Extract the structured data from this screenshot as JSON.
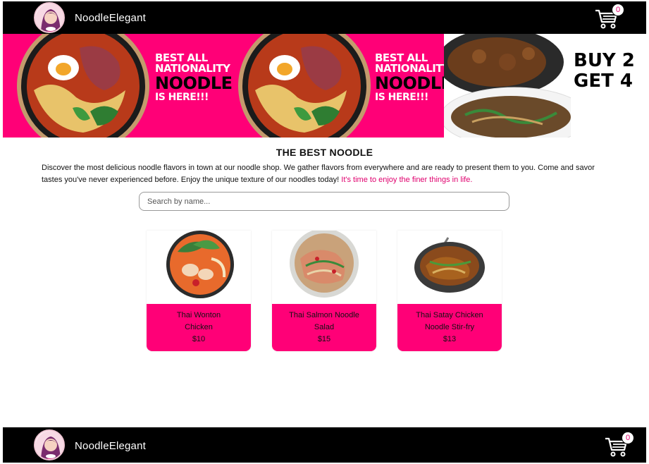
{
  "header": {
    "brand": "NoodleElegant",
    "cart_count": "0",
    "logo_icon": "noodle-girl-avatar-icon",
    "cart_icon": "shopping-cart-icon"
  },
  "banner": {
    "panels": [
      {
        "lines": [
          "BEST ALL",
          "NATIONALITY",
          "NOODLE",
          "IS HERE!!!"
        ]
      },
      {
        "lines": [
          "BEST ALL",
          "NATIONALITY",
          "NOODLE",
          "IS HERE!!!"
        ]
      }
    ],
    "buy_lines": [
      "BUY 2",
      "GET 4"
    ],
    "colors": {
      "background": "#ff0077"
    }
  },
  "main": {
    "title": "THE BEST NOODLE",
    "intro": "Discover the most delicious noodle flavors in town at our noodle shop. We gather flavors from everywhere and are ready to present them to you. Come and savor tastes you've never experienced before. Enjoy the unique texture of our noodles today!",
    "intro_accent": "It's time to enjoy the finer things in life.",
    "search_placeholder": "Search by name..."
  },
  "products": [
    {
      "name": "Thai Wonton Chicken",
      "price": "$10"
    },
    {
      "name": "Thai Salmon Noodle Salad",
      "price": "$15"
    },
    {
      "name": "Thai Satay Chicken Noodle Stir-fry",
      "price": "$13"
    }
  ],
  "footer": {
    "brand": "NoodleElegant",
    "cart_count": "0"
  },
  "colors": {
    "accent": "#ff0077",
    "link": "#e0006e",
    "bar": "#000000"
  }
}
